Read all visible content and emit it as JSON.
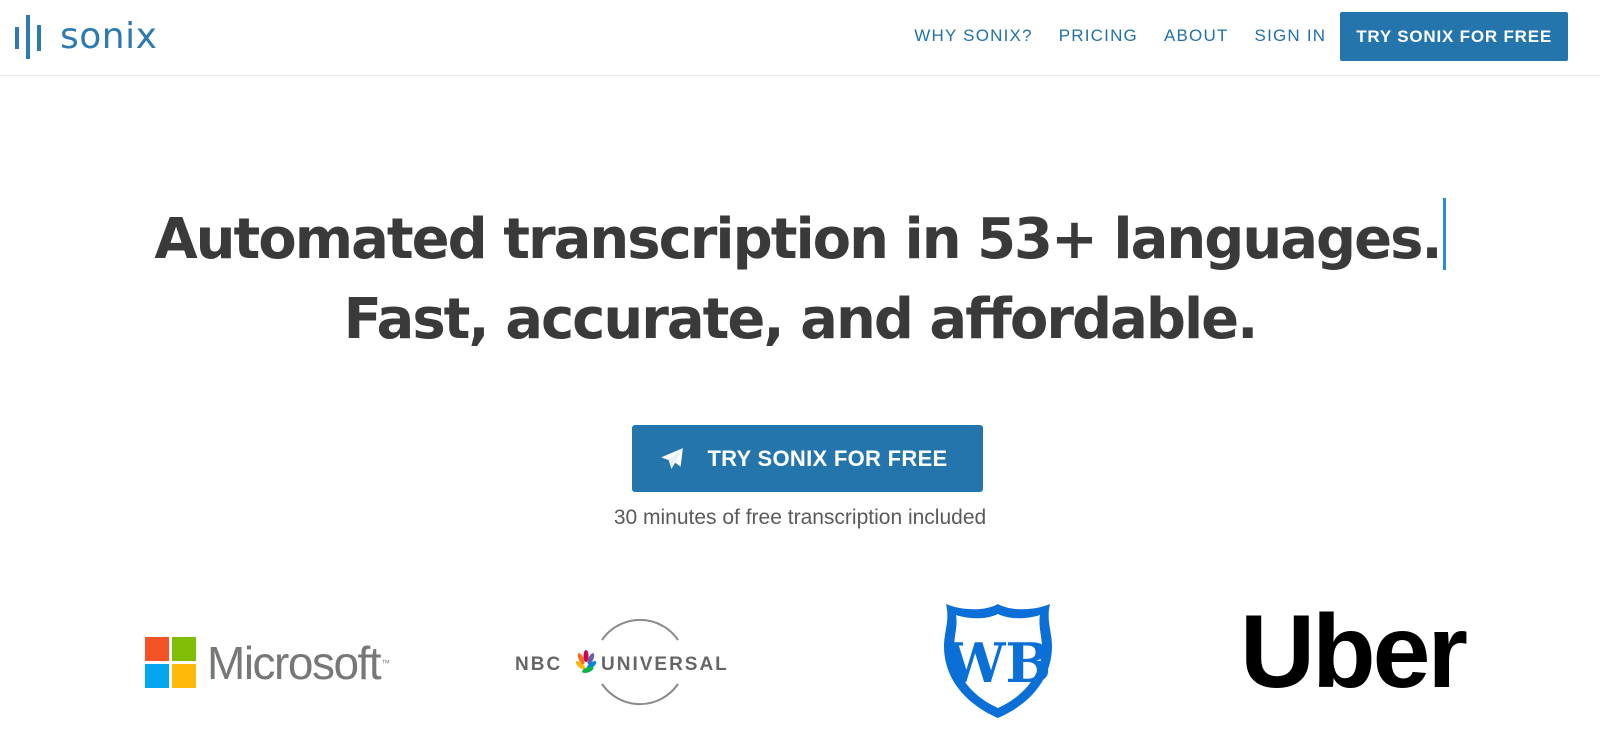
{
  "brand": {
    "name": "sonix",
    "color": "#2c7ab0"
  },
  "nav": {
    "links": [
      {
        "label": "WHY SONIX?"
      },
      {
        "label": "PRICING"
      },
      {
        "label": "ABOUT"
      },
      {
        "label": "SIGN IN"
      }
    ],
    "cta_label": "TRY SONIX FOR FREE"
  },
  "hero": {
    "headline_line1": "Automated transcription in 53+ languages.",
    "headline_line2": "Fast, accurate, and affordable.",
    "cta_label": "TRY SONIX FOR FREE",
    "cta_icon": "paper-plane-icon",
    "subnote": "30 minutes of free transcription included"
  },
  "customer_logos": {
    "microsoft": "Microsoft",
    "nbc_left": "NBC",
    "nbc_right": "UNIVERSAL",
    "wb": "WB",
    "uber": "Uber"
  },
  "colors": {
    "accent": "#2575ad",
    "nav_text": "#2271a8",
    "headline": "#3a3a3a",
    "caret": "#2a8ad8"
  }
}
